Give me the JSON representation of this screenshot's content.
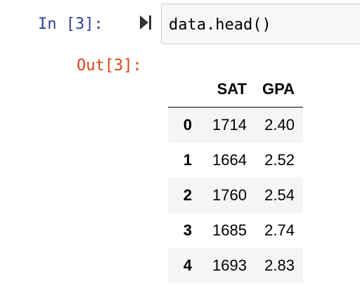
{
  "input_prompt": "In [3]:",
  "output_prompt": "Out[3]:",
  "code": "data.head()",
  "run_icon": "step-forward-icon",
  "table": {
    "columns": [
      "SAT",
      "GPA"
    ],
    "rows": [
      {
        "index": "0",
        "sat": "1714",
        "gpa": "2.40"
      },
      {
        "index": "1",
        "sat": "1664",
        "gpa": "2.52"
      },
      {
        "index": "2",
        "sat": "1760",
        "gpa": "2.54"
      },
      {
        "index": "3",
        "sat": "1685",
        "gpa": "2.74"
      },
      {
        "index": "4",
        "sat": "1693",
        "gpa": "2.83"
      }
    ]
  },
  "colors": {
    "input_prompt": "#303f9f",
    "output_prompt": "#d84315",
    "cell_background": "#f7f7f7",
    "striped_row": "#f5f5f5"
  }
}
